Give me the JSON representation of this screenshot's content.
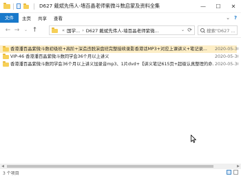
{
  "window": {
    "title": "D627 戴斌先伟人-墙百晶老师紫微斗数启蒙及资料全集",
    "minimize": "—",
    "maximize": "☐",
    "close": "✕"
  },
  "ribbon": {
    "tabs": [
      "文件",
      "主页",
      "共享",
      "查看"
    ],
    "expand": "⌄",
    "help": "?"
  },
  "navigation": {
    "back": "←",
    "forward": "→",
    "up_dropdown": "⌄",
    "up": "↑"
  },
  "address": {
    "overflow": "«",
    "crumbs": [
      "国学...",
      "D627 戴斌先伟人-墙百晶老师紫微..."
    ],
    "separator": "›",
    "dropdown": "⌄",
    "refresh": "⟳"
  },
  "search": {
    "placeholder": "搜索\"D627 ..."
  },
  "files": [
    {
      "name": "香港潘百晶紫微斗数初级班+高阶+深造违脱演盘班完整接续录影香港话MP3+对应上课讲义+笔记录...",
      "date": "2020-05-30",
      "type": "folder",
      "selected": true
    },
    {
      "name": "VIP-46 香港潘百晶紫微斗数同学会36个月以上讲义",
      "date": "2020-05-30",
      "type": "folder",
      "selected": false
    },
    {
      "name": "香港潘百晶紫微斗数同学会36个月以上讲义加录音mp3、1片dvd+【讲义笔记615页+超级认真整理的命...",
      "date": "2020-05-30",
      "type": "folder",
      "selected": false
    }
  ],
  "status": {
    "item_count": "3 个项目"
  },
  "colors": {
    "accent": "#1979ca",
    "folder": "#f6cf57",
    "selection": "#fdeec6"
  }
}
